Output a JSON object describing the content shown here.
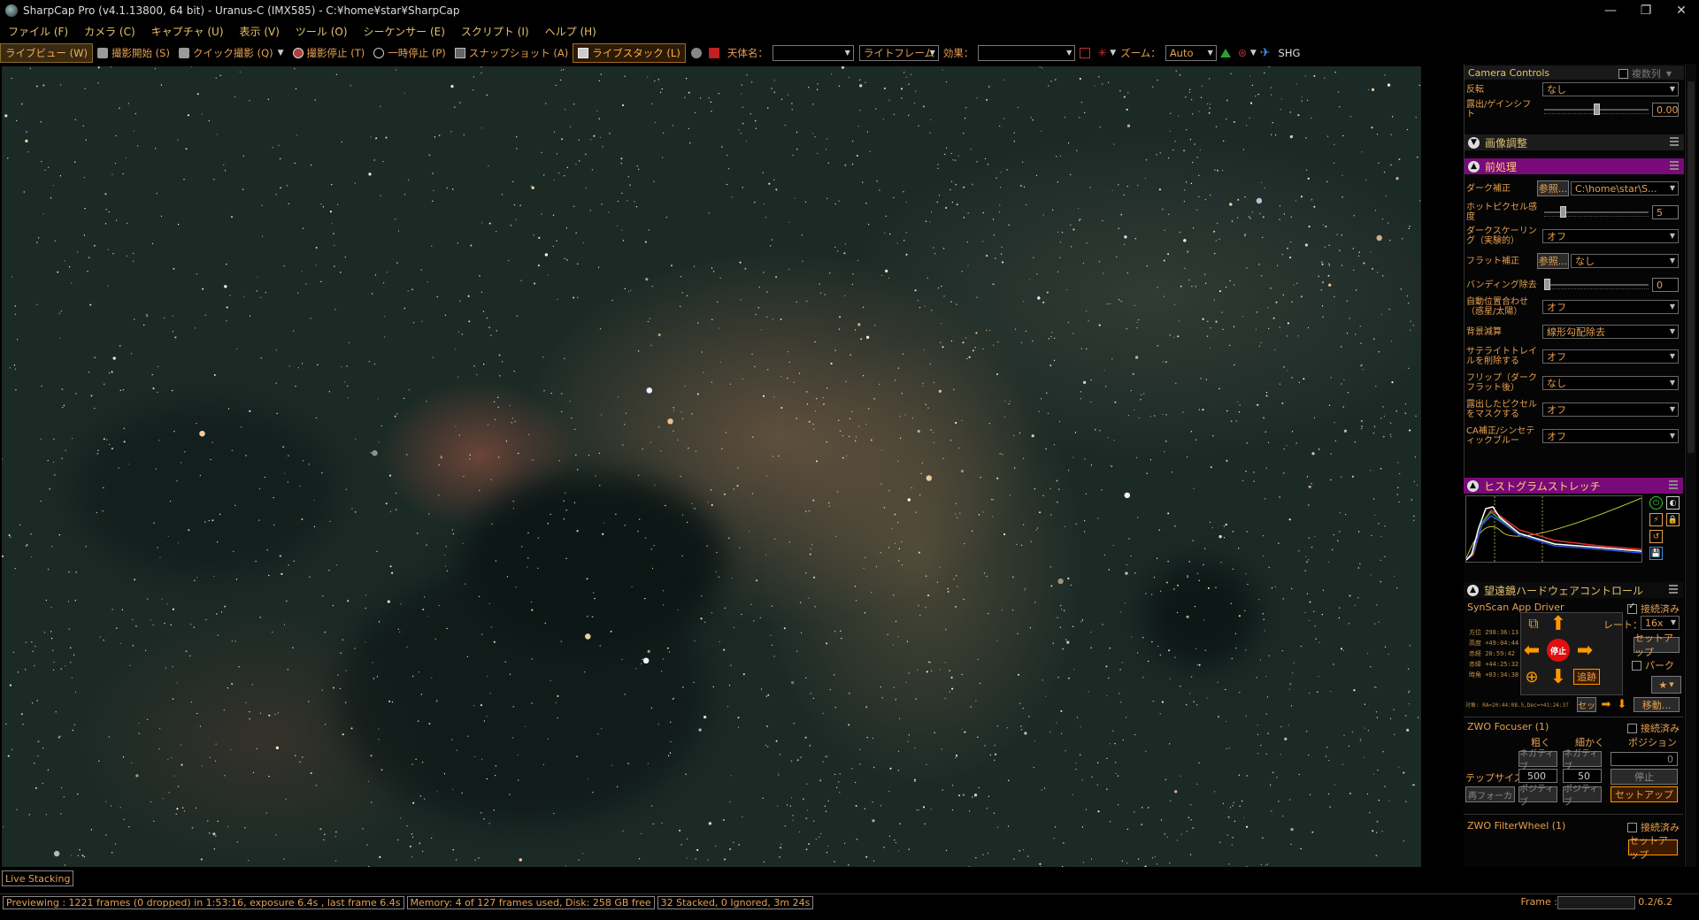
{
  "window": {
    "title": "SharpCap Pro (v4.1.13800, 64 bit) - Uranus-C (IMX585) - C:¥home¥star¥SharpCap",
    "controls": [
      "minimize-icon",
      "restore-icon",
      "close-icon"
    ]
  },
  "menu": [
    "ファイル (F)",
    "カメラ (C)",
    "キャプチャ (U)",
    "表示 (V)",
    "ツール (O)",
    "シーケンサー (E)",
    "スクリプト (I)",
    "ヘルプ (H)"
  ],
  "toolbar": {
    "live_view": "ライブビュー (W)",
    "start_capture": "撮影開始 (S)",
    "quick_capture": "クイック撮影 (Q)",
    "stop_capture": "撮影停止 (T)",
    "pause": "一時停止 (P)",
    "snapshot": "スナップショット (A)",
    "live_stack": "ライブスタック (L)",
    "target_label": "天体名：",
    "target_value": "",
    "frame_type": "ライトフレーム",
    "effect_label": "効果：",
    "effect_value": "",
    "zoom_label": "ズーム：",
    "zoom_value": "Auto",
    "shg": "SHG"
  },
  "panel": {
    "camera_controls": "Camera Controls",
    "multi_column": "複数列",
    "flip_label": "反転",
    "flip_value": "なし",
    "exposure_gain_label": "露出/ゲインシフト",
    "exposure_gain_value": "0.00",
    "image_adjust": "画像調整",
    "preprocess": "前処理",
    "dark_label": "ダーク補正",
    "browse": "参照...",
    "dark_value": "C:\\home\\star\\S...",
    "hotpixel_label": "ホットピクセル感度",
    "hotpixel_value": "5",
    "dark_scaling_label": "ダークスケーリング（実験的）",
    "dark_scaling_value": "オフ",
    "flat_label": "フラット補正",
    "flat_value": "なし",
    "banding_label": "バンディング除去",
    "banding_value": "0",
    "auto_align_label": "自動位置合わせ（惑星/太陽）",
    "auto_align_value": "オフ",
    "bg_sub_label": "背景減算",
    "bg_sub_value": "線形勾配除去",
    "sat_trail_label": "サテライトトレイルを削除する",
    "sat_trail_value": "オフ",
    "flip_dark_label": "フリップ（ダークフラット後）",
    "flip_dark_value": "なし",
    "mask_label": "露出したピクセルをマスクする",
    "mask_value": "オフ",
    "ca_label": "CA補正/シンセティックブルー",
    "ca_value": "オフ",
    "histogram": "ヒストグラムストレッチ",
    "scope_hw": "望遠鏡ハードウェアコントロール",
    "synscan": "SynScan App Driver",
    "connected": "接続済み",
    "rate_label": "レート：",
    "rate_value": "16x",
    "setup": "セットアップ",
    "park": "パーク",
    "track": "追跡",
    "stop": "停止",
    "coords": [
      "方位  298:36:13",
      "高度  +49:04:44",
      "赤経   20:59:42",
      "赤緯  +44:25:32",
      "時角  +03:34:38"
    ],
    "target_coord": "対象: RA=20:44:08.5,Dec=+41:24:37",
    "set_short": "セッ",
    "move": "移動...",
    "focuser": "ZWO Focuser (1)",
    "coarse": "粗く",
    "fine": "細かく",
    "position": "ポジション",
    "negative": "ネガティブ",
    "positive": "ポジティブ",
    "position_value": "0",
    "step_size_label": "テップサイズ",
    "step_coarse": "500",
    "step_fine": "50",
    "focuser_stop": "停止",
    "refocus": "再フォーカ",
    "filterwheel": "ZWO FilterWheel (1)"
  },
  "bottom_tab": "Live Stacking",
  "status": {
    "preview": "Previewing : 1221 frames (0 dropped) in 1:53:16, exposure 6.4s , last frame 6.4s",
    "memory": "Memory: 4 of 127 frames used, Disk: 258 GB free",
    "stacked": "32 Stacked, 0 Ignored, 3m 24s",
    "frame_label": "Frame :",
    "frame_value": "0.2/6.2"
  },
  "colors": {
    "accent": "#e6a050",
    "section_purple": "#7a0a7a",
    "stop_red": "#e01010",
    "arrow_orange": "#ff9800"
  }
}
